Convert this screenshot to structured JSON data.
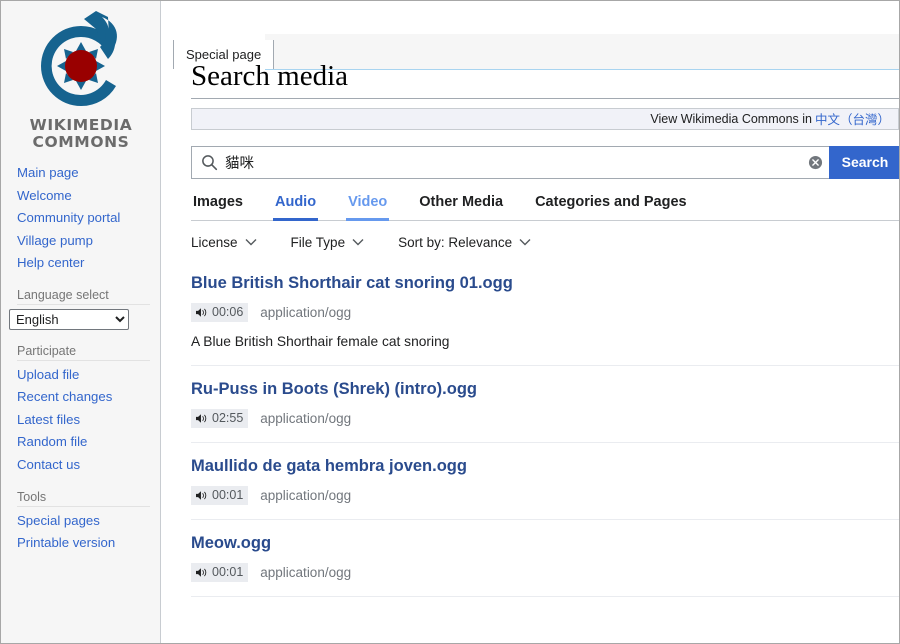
{
  "sidebar": {
    "logo": {
      "line1": "WIKIMEDIA",
      "line2": "COMMONS",
      "icon": "wikimedia-commons-logo"
    },
    "portals": [
      {
        "id": "navigation",
        "heading": "",
        "items": [
          {
            "label": "Main page",
            "name": "sidebar-item-main-page"
          },
          {
            "label": "Welcome",
            "name": "sidebar-item-welcome"
          },
          {
            "label": "Community portal",
            "name": "sidebar-item-community-portal"
          },
          {
            "label": "Village pump",
            "name": "sidebar-item-village-pump"
          },
          {
            "label": "Help center",
            "name": "sidebar-item-help-center"
          }
        ]
      },
      {
        "id": "participate",
        "heading": "Participate",
        "items": [
          {
            "label": "Upload file",
            "name": "sidebar-item-upload-file"
          },
          {
            "label": "Recent changes",
            "name": "sidebar-item-recent-changes"
          },
          {
            "label": "Latest files",
            "name": "sidebar-item-latest-files"
          },
          {
            "label": "Random file",
            "name": "sidebar-item-random-file"
          },
          {
            "label": "Contact us",
            "name": "sidebar-item-contact-us"
          }
        ]
      },
      {
        "id": "tools",
        "heading": "Tools",
        "items": [
          {
            "label": "Special pages",
            "name": "sidebar-item-special-pages"
          },
          {
            "label": "Printable version",
            "name": "sidebar-item-printable-version"
          }
        ]
      }
    ],
    "language": {
      "heading": "Language select",
      "selected": "English",
      "options": [
        "English"
      ]
    }
  },
  "tabs": {
    "page_tab": "Special page"
  },
  "main": {
    "title": "Search media",
    "notice": {
      "text": "View Wikimedia Commons in",
      "language_link": "中文（台灣）"
    },
    "search": {
      "value": "貓咪",
      "placeholder": "Search",
      "submit_label": "Search",
      "search_icon": "search-icon",
      "clear_icon": "clear-circle-icon"
    },
    "media_tabs": [
      {
        "label": "Images",
        "state": "default"
      },
      {
        "label": "Audio",
        "state": "active"
      },
      {
        "label": "Video",
        "state": "hovered"
      },
      {
        "label": "Other Media",
        "state": "default"
      },
      {
        "label": "Categories and Pages",
        "state": "default"
      }
    ],
    "filters": [
      {
        "label": "License",
        "name": "filter-license"
      },
      {
        "label": "File Type",
        "name": "filter-file-type"
      },
      {
        "label": "Sort by: Relevance",
        "name": "filter-sort-by"
      }
    ],
    "results": [
      {
        "title": "Blue British Shorthair cat snoring 01.ogg",
        "duration": "00:06",
        "mime": "application/ogg",
        "description": "A Blue British Shorthair female cat snoring"
      },
      {
        "title": "Ru-Puss in Boots (Shrek) (intro).ogg",
        "duration": "02:55",
        "mime": "application/ogg",
        "description": ""
      },
      {
        "title": "Maullido de gata hembra joven.ogg",
        "duration": "00:01",
        "mime": "application/ogg",
        "description": ""
      },
      {
        "title": "Meow.ogg",
        "duration": "00:01",
        "mime": "application/ogg",
        "description": ""
      }
    ]
  },
  "colors": {
    "link": "#3366cc",
    "result_title": "#2a4b8d",
    "accent_button": "#3366cc",
    "tab_hover": "#6699ee",
    "logo_blue": "#16638f",
    "logo_red": "#990000"
  }
}
